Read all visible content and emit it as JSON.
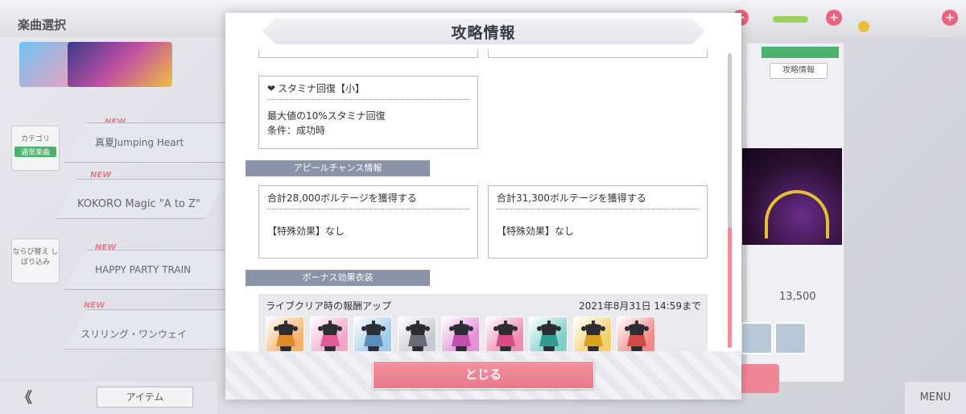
{
  "modal": {
    "title": "攻略情報",
    "close_label": "とじる"
  },
  "skill_card": {
    "title": "スタミナ回復【小】",
    "line1": "最大値の10%スタミナ回復",
    "line2": "条件：成功時"
  },
  "appeal_section": {
    "label": "アピールチャンス情報",
    "cards": [
      {
        "title": "合計28,000ボルテージを獲得する",
        "effect": "【特殊効果】なし"
      },
      {
        "title": "合計31,300ボルテージを獲得する",
        "effect": "【特殊効果】なし"
      }
    ]
  },
  "bonus_section": {
    "label": "ボーナス効果衣装",
    "heading": "ライブクリア時の報酬アップ",
    "deadline": "2021年8月31日 14:59まで",
    "costumes": [
      {
        "bg": "#f6b26b",
        "accent": "#e08a2c"
      },
      {
        "bg": "#f3a6c8",
        "accent": "#e05c9a"
      },
      {
        "bg": "#9fcbe8",
        "accent": "#5a8fb8"
      },
      {
        "bg": "#c9c9d2",
        "accent": "#6b6b78"
      },
      {
        "bg": "#e68fd8",
        "accent": "#c04fb0"
      },
      {
        "bg": "#f08bb0",
        "accent": "#d94c86"
      },
      {
        "bg": "#7fd0c8",
        "accent": "#2f9c92"
      },
      {
        "bg": "#f3d06a",
        "accent": "#d9a320"
      },
      {
        "bg": "#f28a8a",
        "accent": "#d04a4a"
      }
    ]
  },
  "background": {
    "screen_title": "楽曲選択",
    "songs": [
      "真夏Jumping Heart",
      "KOKORO Magic \"A to Z\"",
      "HAPPY PARTY TRAIN",
      "スリリング・ワンウェイ"
    ],
    "new_label": "NEW",
    "category_label": "カテゴリ",
    "category_value": "通常楽曲",
    "sort_label": "ならび替え しぼり込み",
    "item_label": "アイテム",
    "menu_label": "MENU",
    "attack_info_label": "攻略情報",
    "score": "13,500",
    "back_label": "《"
  }
}
